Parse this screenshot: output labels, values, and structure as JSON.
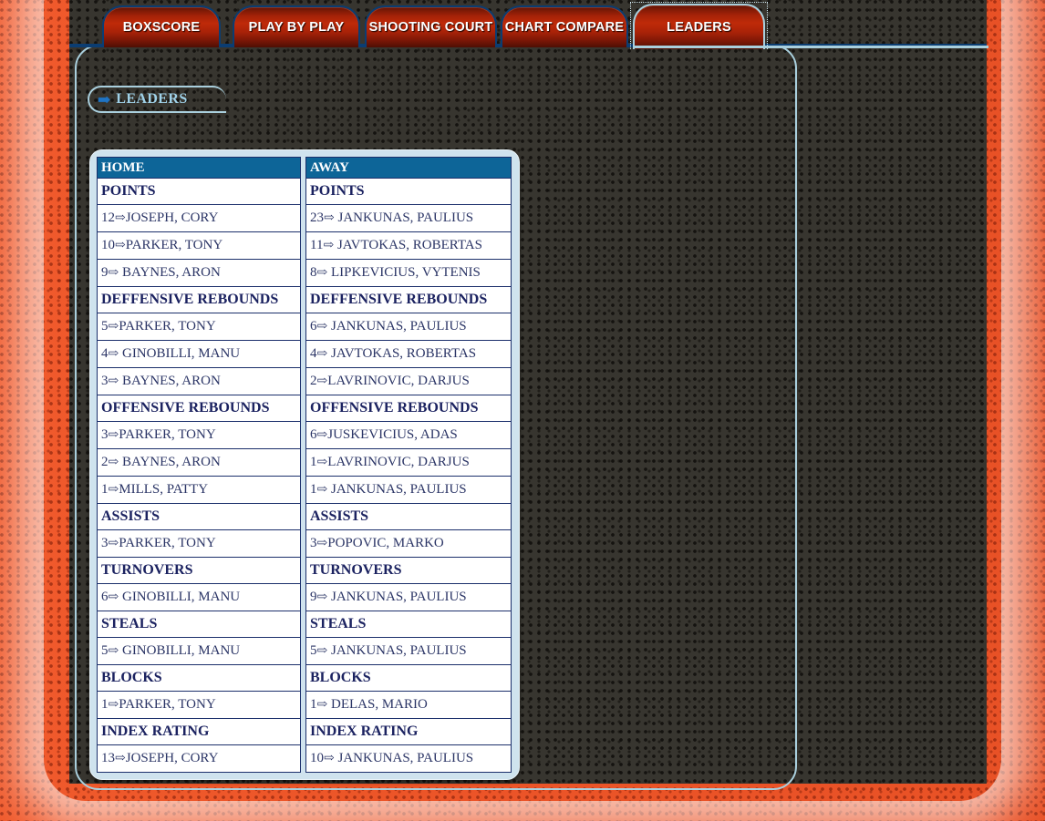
{
  "tabs": [
    {
      "label": "BOXSCORE",
      "active": false
    },
    {
      "label": "PLAY BY PLAY",
      "active": false
    },
    {
      "label": "SHOOTING COURT",
      "active": false
    },
    {
      "label": "CHART COMPARE",
      "active": false
    },
    {
      "label": "LEADERS",
      "active": true
    }
  ],
  "section": {
    "arrow_icon": "➡",
    "title": "LEADERS"
  },
  "colors": {
    "table_header_blue": "#0d6598",
    "panel_border": "#a9cfdd",
    "tab_border": "#0b3d72",
    "tab_red": "#a52208",
    "court_orange": "#e85a33",
    "field_dark": "#37352f",
    "text_navy": "#1b2260"
  },
  "table": {
    "home_header": "HOME",
    "away_header": "AWAY",
    "arrow": "⇨",
    "sections": [
      {
        "category": "POINTS",
        "home": [
          {
            "value": "12",
            "name": "JOSEPH, CORY"
          },
          {
            "value": "10",
            "name": "PARKER, TONY"
          },
          {
            "value": "9",
            "name": " BAYNES, ARON"
          }
        ],
        "away": [
          {
            "value": "23",
            "name": " JANKUNAS, PAULIUS"
          },
          {
            "value": "11",
            "name": " JAVTOKAS, ROBERTAS"
          },
          {
            "value": "8",
            "name": " LIPKEVICIUS, VYTENIS"
          }
        ]
      },
      {
        "category": "DEFFENSIVE REBOUNDS",
        "home": [
          {
            "value": "5",
            "name": "PARKER, TONY"
          },
          {
            "value": "4",
            "name": " GINOBILLI, MANU"
          },
          {
            "value": "3",
            "name": " BAYNES, ARON"
          }
        ],
        "away": [
          {
            "value": "6",
            "name": " JANKUNAS, PAULIUS"
          },
          {
            "value": "4",
            "name": " JAVTOKAS, ROBERTAS"
          },
          {
            "value": "2",
            "name": "LAVRINOVIC, DARJUS"
          }
        ]
      },
      {
        "category": "OFFENSIVE REBOUNDS",
        "home": [
          {
            "value": "3",
            "name": "PARKER, TONY"
          },
          {
            "value": "2",
            "name": " BAYNES, ARON"
          },
          {
            "value": "1",
            "name": "MILLS, PATTY"
          }
        ],
        "away": [
          {
            "value": "6",
            "name": "JUSKEVICIUS, ADAS"
          },
          {
            "value": "1",
            "name": "LAVRINOVIC, DARJUS"
          },
          {
            "value": "1",
            "name": " JANKUNAS, PAULIUS"
          }
        ]
      },
      {
        "category": "ASSISTS",
        "home": [
          {
            "value": "3",
            "name": "PARKER, TONY"
          }
        ],
        "away": [
          {
            "value": "3",
            "name": "POPOVIC, MARKO"
          }
        ]
      },
      {
        "category": "TURNOVERS",
        "home": [
          {
            "value": "6",
            "name": " GINOBILLI, MANU"
          }
        ],
        "away": [
          {
            "value": "9",
            "name": " JANKUNAS, PAULIUS"
          }
        ]
      },
      {
        "category": "STEALS",
        "home": [
          {
            "value": "5",
            "name": " GINOBILLI, MANU"
          }
        ],
        "away": [
          {
            "value": "5",
            "name": " JANKUNAS, PAULIUS"
          }
        ]
      },
      {
        "category": "BLOCKS",
        "home": [
          {
            "value": "1",
            "name": "PARKER, TONY"
          }
        ],
        "away": [
          {
            "value": "1",
            "name": " DELAS, MARIO"
          }
        ]
      },
      {
        "category": "INDEX RATING",
        "home": [
          {
            "value": "13",
            "name": "JOSEPH, CORY"
          }
        ],
        "away": [
          {
            "value": "10",
            "name": " JANKUNAS, PAULIUS"
          }
        ]
      }
    ]
  }
}
